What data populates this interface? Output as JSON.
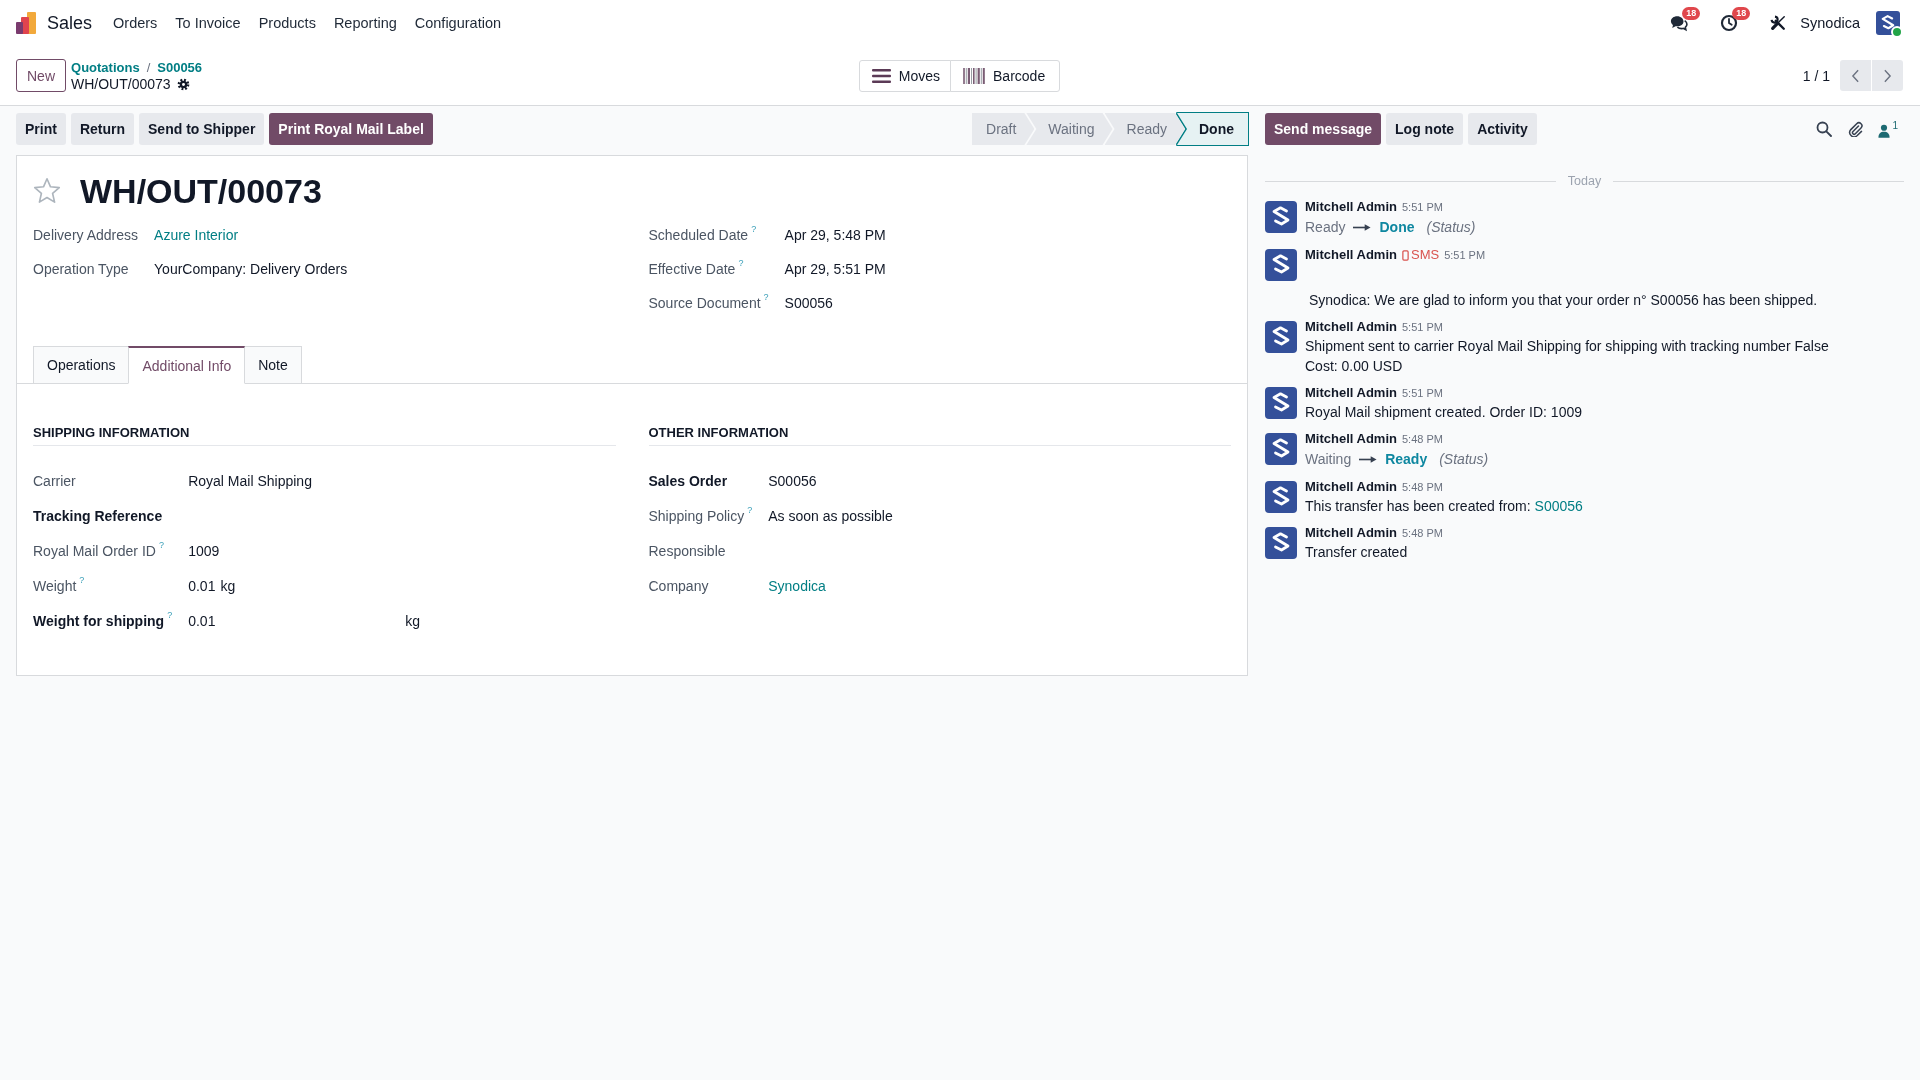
{
  "navbar": {
    "app_name": "Sales",
    "menu": [
      "Orders",
      "To Invoice",
      "Products",
      "Reporting",
      "Configuration"
    ],
    "messages_count": "18",
    "activities_count": "18",
    "company": "Synodica",
    "user_online": true
  },
  "control_panel": {
    "new_button": "New",
    "breadcrumbs": [
      "Quotations",
      "S00056"
    ],
    "breadcrumb_separator": "/",
    "current_record": "WH/OUT/00073",
    "smart_buttons": [
      {
        "kind": "moves",
        "label": "Moves"
      },
      {
        "kind": "barcode",
        "label": "Barcode"
      }
    ],
    "pager": "1 / 1"
  },
  "action_buttons": [
    {
      "label": "Print",
      "primary": false
    },
    {
      "label": "Return",
      "primary": false
    },
    {
      "label": "Send to Shipper",
      "primary": false
    },
    {
      "label": "Print Royal Mail Label",
      "primary": true
    }
  ],
  "statusbar": [
    {
      "label": "Draft",
      "selected": false
    },
    {
      "label": "Waiting",
      "selected": false
    },
    {
      "label": "Ready",
      "selected": false
    },
    {
      "label": "Done",
      "selected": true
    }
  ],
  "form": {
    "starred": false,
    "title": "WH/OUT/00073",
    "header_fields": {
      "left": [
        {
          "label": "Delivery Address",
          "kind": "link",
          "value": "Azure Interior"
        },
        {
          "label": "Operation Type",
          "kind": "text",
          "value": "YourCompany: Delivery Orders"
        }
      ],
      "right": [
        {
          "label": "Scheduled Date",
          "help": "?",
          "kind": "text",
          "value": "Apr 29, 5:48 PM"
        },
        {
          "label": "Effective Date",
          "help": "?",
          "kind": "text",
          "value": "Apr 29, 5:51 PM"
        },
        {
          "label": "Source Document",
          "help": "?",
          "kind": "text",
          "value": "S00056"
        }
      ]
    },
    "tabs": [
      {
        "label": "Operations",
        "selected": false
      },
      {
        "label": "Additional Info",
        "selected": true
      },
      {
        "label": "Note",
        "selected": false
      }
    ],
    "groups": [
      {
        "title": "SHIPPING INFORMATION",
        "fields": [
          {
            "label": "Carrier",
            "bold": false,
            "kind": "text",
            "value": "Royal Mail Shipping"
          },
          {
            "label": "Tracking Reference",
            "bold": true
          },
          {
            "label": "Royal Mail Order ID",
            "help": "?",
            "bold": false,
            "kind": "text",
            "value": "1009"
          },
          {
            "label": "Weight",
            "help": "?",
            "bold": false,
            "kind": "text",
            "value": "0.01",
            "unit": "kg"
          },
          {
            "label": "Weight for shipping",
            "help": "?",
            "bold": true,
            "kind": "input",
            "value": "0.01",
            "unit": "kg"
          }
        ]
      },
      {
        "title": "OTHER INFORMATION",
        "fields": [
          {
            "label": "Sales Order",
            "bold": true,
            "kind": "text",
            "value": "S00056"
          },
          {
            "label": "Shipping Policy",
            "help": "?",
            "bold": false,
            "kind": "text",
            "value": "As soon as possible"
          },
          {
            "label": "Responsible",
            "bold": false
          },
          {
            "label": "Company",
            "bold": false,
            "kind": "link",
            "value": "Synodica"
          }
        ]
      }
    ]
  },
  "chatter": {
    "buttons": [
      {
        "label": "Send message",
        "primary": true
      },
      {
        "label": "Log note",
        "primary": false
      },
      {
        "label": "Activity",
        "primary": false
      }
    ],
    "followers_count": "1",
    "date_separator": "Today",
    "messages": [
      {
        "author": "Mitchell Admin",
        "time": "5:51 PM",
        "kind": "tracking",
        "old_value": "Ready",
        "new_value": "Done",
        "field": "(Status)"
      },
      {
        "author": "Mitchell Admin",
        "channel": "SMS",
        "time": "5:51 PM",
        "kind": "sms",
        "lines": [
          "Synodica: We are glad to inform you that your order n° S00056 has been shipped."
        ]
      },
      {
        "author": "Mitchell Admin",
        "time": "5:51 PM",
        "kind": "note",
        "lines": [
          "Shipment sent to carrier Royal Mail Shipping for shipping with tracking number False",
          "Cost: 0.00 USD"
        ]
      },
      {
        "author": "Mitchell Admin",
        "time": "5:51 PM",
        "kind": "note",
        "lines": [
          "Royal Mail shipment created. Order ID: 1009"
        ]
      },
      {
        "author": "Mitchell Admin",
        "time": "5:48 PM",
        "kind": "tracking",
        "old_value": "Waiting",
        "new_value": "Ready",
        "field": "(Status)"
      },
      {
        "author": "Mitchell Admin",
        "time": "5:48 PM",
        "kind": "note",
        "lines": [
          "This transfer has been created from:"
        ],
        "link": "S00056"
      },
      {
        "author": "Mitchell Admin",
        "time": "5:48 PM",
        "kind": "note",
        "lines": [
          "Transfer created"
        ]
      }
    ]
  }
}
